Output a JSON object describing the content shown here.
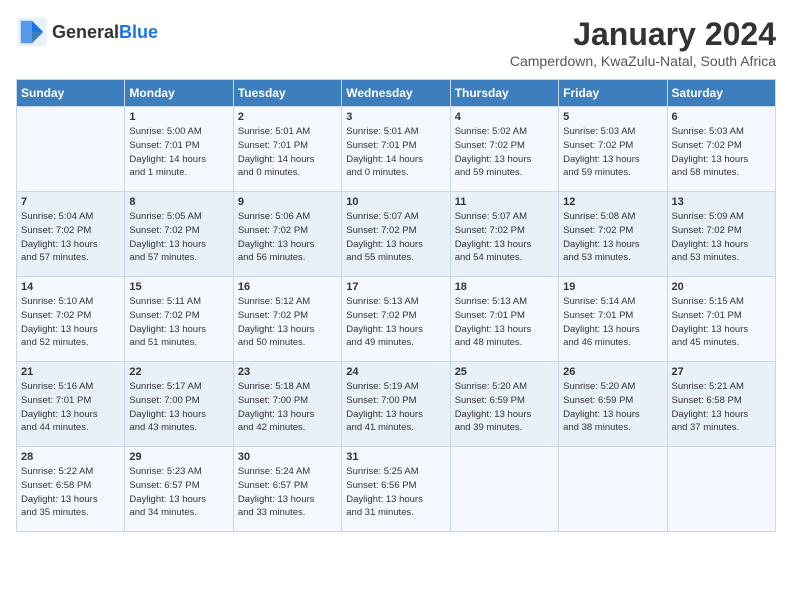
{
  "header": {
    "logo_general": "General",
    "logo_blue": "Blue",
    "month": "January 2024",
    "location": "Camperdown, KwaZulu-Natal, South Africa"
  },
  "columns": [
    "Sunday",
    "Monday",
    "Tuesday",
    "Wednesday",
    "Thursday",
    "Friday",
    "Saturday"
  ],
  "weeks": [
    [
      {
        "day": "",
        "info": ""
      },
      {
        "day": "1",
        "info": "Sunrise: 5:00 AM\nSunset: 7:01 PM\nDaylight: 14 hours\nand 1 minute."
      },
      {
        "day": "2",
        "info": "Sunrise: 5:01 AM\nSunset: 7:01 PM\nDaylight: 14 hours\nand 0 minutes."
      },
      {
        "day": "3",
        "info": "Sunrise: 5:01 AM\nSunset: 7:01 PM\nDaylight: 14 hours\nand 0 minutes."
      },
      {
        "day": "4",
        "info": "Sunrise: 5:02 AM\nSunset: 7:02 PM\nDaylight: 13 hours\nand 59 minutes."
      },
      {
        "day": "5",
        "info": "Sunrise: 5:03 AM\nSunset: 7:02 PM\nDaylight: 13 hours\nand 59 minutes."
      },
      {
        "day": "6",
        "info": "Sunrise: 5:03 AM\nSunset: 7:02 PM\nDaylight: 13 hours\nand 58 minutes."
      }
    ],
    [
      {
        "day": "7",
        "info": "Sunrise: 5:04 AM\nSunset: 7:02 PM\nDaylight: 13 hours\nand 57 minutes."
      },
      {
        "day": "8",
        "info": "Sunrise: 5:05 AM\nSunset: 7:02 PM\nDaylight: 13 hours\nand 57 minutes."
      },
      {
        "day": "9",
        "info": "Sunrise: 5:06 AM\nSunset: 7:02 PM\nDaylight: 13 hours\nand 56 minutes."
      },
      {
        "day": "10",
        "info": "Sunrise: 5:07 AM\nSunset: 7:02 PM\nDaylight: 13 hours\nand 55 minutes."
      },
      {
        "day": "11",
        "info": "Sunrise: 5:07 AM\nSunset: 7:02 PM\nDaylight: 13 hours\nand 54 minutes."
      },
      {
        "day": "12",
        "info": "Sunrise: 5:08 AM\nSunset: 7:02 PM\nDaylight: 13 hours\nand 53 minutes."
      },
      {
        "day": "13",
        "info": "Sunrise: 5:09 AM\nSunset: 7:02 PM\nDaylight: 13 hours\nand 53 minutes."
      }
    ],
    [
      {
        "day": "14",
        "info": "Sunrise: 5:10 AM\nSunset: 7:02 PM\nDaylight: 13 hours\nand 52 minutes."
      },
      {
        "day": "15",
        "info": "Sunrise: 5:11 AM\nSunset: 7:02 PM\nDaylight: 13 hours\nand 51 minutes."
      },
      {
        "day": "16",
        "info": "Sunrise: 5:12 AM\nSunset: 7:02 PM\nDaylight: 13 hours\nand 50 minutes."
      },
      {
        "day": "17",
        "info": "Sunrise: 5:13 AM\nSunset: 7:02 PM\nDaylight: 13 hours\nand 49 minutes."
      },
      {
        "day": "18",
        "info": "Sunrise: 5:13 AM\nSunset: 7:01 PM\nDaylight: 13 hours\nand 48 minutes."
      },
      {
        "day": "19",
        "info": "Sunrise: 5:14 AM\nSunset: 7:01 PM\nDaylight: 13 hours\nand 46 minutes."
      },
      {
        "day": "20",
        "info": "Sunrise: 5:15 AM\nSunset: 7:01 PM\nDaylight: 13 hours\nand 45 minutes."
      }
    ],
    [
      {
        "day": "21",
        "info": "Sunrise: 5:16 AM\nSunset: 7:01 PM\nDaylight: 13 hours\nand 44 minutes."
      },
      {
        "day": "22",
        "info": "Sunrise: 5:17 AM\nSunset: 7:00 PM\nDaylight: 13 hours\nand 43 minutes."
      },
      {
        "day": "23",
        "info": "Sunrise: 5:18 AM\nSunset: 7:00 PM\nDaylight: 13 hours\nand 42 minutes."
      },
      {
        "day": "24",
        "info": "Sunrise: 5:19 AM\nSunset: 7:00 PM\nDaylight: 13 hours\nand 41 minutes."
      },
      {
        "day": "25",
        "info": "Sunrise: 5:20 AM\nSunset: 6:59 PM\nDaylight: 13 hours\nand 39 minutes."
      },
      {
        "day": "26",
        "info": "Sunrise: 5:20 AM\nSunset: 6:59 PM\nDaylight: 13 hours\nand 38 minutes."
      },
      {
        "day": "27",
        "info": "Sunrise: 5:21 AM\nSunset: 6:58 PM\nDaylight: 13 hours\nand 37 minutes."
      }
    ],
    [
      {
        "day": "28",
        "info": "Sunrise: 5:22 AM\nSunset: 6:58 PM\nDaylight: 13 hours\nand 35 minutes."
      },
      {
        "day": "29",
        "info": "Sunrise: 5:23 AM\nSunset: 6:57 PM\nDaylight: 13 hours\nand 34 minutes."
      },
      {
        "day": "30",
        "info": "Sunrise: 5:24 AM\nSunset: 6:57 PM\nDaylight: 13 hours\nand 33 minutes."
      },
      {
        "day": "31",
        "info": "Sunrise: 5:25 AM\nSunset: 6:56 PM\nDaylight: 13 hours\nand 31 minutes."
      },
      {
        "day": "",
        "info": ""
      },
      {
        "day": "",
        "info": ""
      },
      {
        "day": "",
        "info": ""
      }
    ]
  ]
}
